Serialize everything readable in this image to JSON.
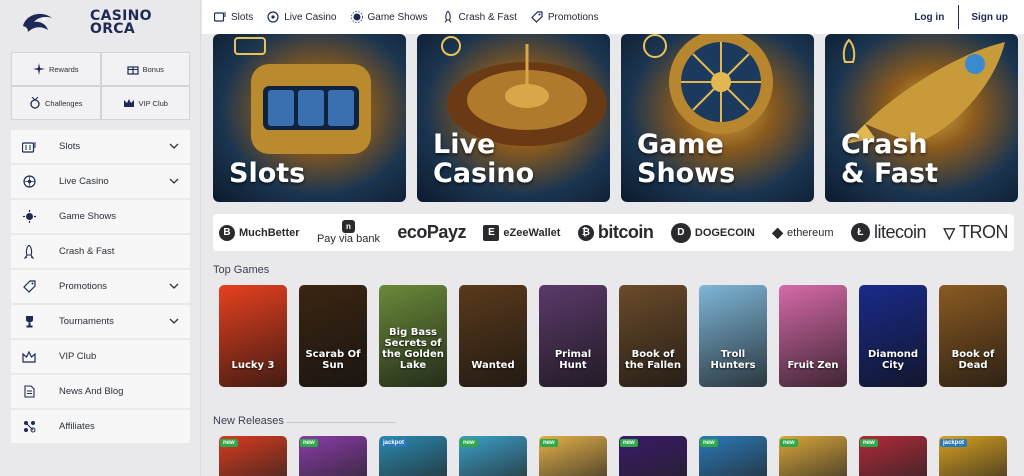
{
  "brand": {
    "line1": "CASINO",
    "line2": "ORCA",
    "color": "#1e2a55"
  },
  "quick_links": [
    {
      "label": "Rewards",
      "icon": "sparkle-icon"
    },
    {
      "label": "Bonus",
      "icon": "gift-icon"
    },
    {
      "label": "Challenges",
      "icon": "medal-icon"
    },
    {
      "label": "VIP Club",
      "icon": "crown-icon"
    }
  ],
  "sidebar": {
    "items": [
      {
        "label": "Slots",
        "icon": "slot-machine-icon",
        "has_chevron": true
      },
      {
        "label": "Live Casino",
        "icon": "roulette-icon",
        "has_chevron": true
      },
      {
        "label": "Game Shows",
        "icon": "wheel-icon",
        "has_chevron": false
      },
      {
        "label": "Crash & Fast",
        "icon": "rocket-icon",
        "has_chevron": false
      },
      {
        "label": "Promotions",
        "icon": "tag-icon",
        "has_chevron": true
      },
      {
        "label": "Tournaments",
        "icon": "trophy-icon",
        "has_chevron": true
      },
      {
        "label": "VIP Club",
        "icon": "crown-icon",
        "has_chevron": false
      },
      {
        "label": "News And Blog",
        "icon": "document-icon",
        "has_chevron": false
      },
      {
        "label": "Affiliates",
        "icon": "network-icon",
        "has_chevron": false
      }
    ]
  },
  "topnav": {
    "items": [
      {
        "label": "Slots",
        "icon": "slot-machine-icon"
      },
      {
        "label": "Live Casino",
        "icon": "roulette-icon"
      },
      {
        "label": "Game Shows",
        "icon": "wheel-icon"
      },
      {
        "label": "Crash & Fast",
        "icon": "rocket-icon"
      },
      {
        "label": "Promotions",
        "icon": "tag-icon"
      }
    ],
    "login": "Log in",
    "signup": "Sign up"
  },
  "heroes": [
    {
      "line1": "Slots",
      "line2": ""
    },
    {
      "line1": "Live",
      "line2": "Casino"
    },
    {
      "line1": "Game",
      "line2": "Shows"
    },
    {
      "line1": "Crash",
      "line2": "& Fast"
    }
  ],
  "payments": [
    "MuchBetter",
    "Pay via bank",
    "ecoPayz",
    "eZeeWallet",
    "bitcoin",
    "DOGECOIN",
    "ethereum",
    "litecoin",
    "TRON"
  ],
  "top_games": {
    "title": "Top Games",
    "games": [
      {
        "name": "Lucky 3",
        "bg": "#e8401f"
      },
      {
        "name": "Scarab Of Sun",
        "bg": "#3b2512"
      },
      {
        "name": "Big Bass Secrets of the Golden Lake",
        "bg": "#6a8a3a"
      },
      {
        "name": "Wanted",
        "bg": "#5a3a1c"
      },
      {
        "name": "Primal Hunt",
        "bg": "#5b3a6a"
      },
      {
        "name": "Book of the Fallen",
        "bg": "#6b4b2a"
      },
      {
        "name": "Troll Hunters",
        "bg": "#7fb6d8"
      },
      {
        "name": "Fruit Zen",
        "bg": "#d66aa8"
      },
      {
        "name": "Diamond City",
        "bg": "#1a2a8a"
      },
      {
        "name": "Book of Dead",
        "bg": "#8a5a22"
      }
    ]
  },
  "new_releases": {
    "title": "New Releases",
    "tiles": [
      {
        "badge": "new",
        "bg": "#d93b1f"
      },
      {
        "badge": "new",
        "bg": "#8a3ca8"
      },
      {
        "badge": "jackpot",
        "bg": "#2a8ab0"
      },
      {
        "badge": "new",
        "bg": "#3aa0c8"
      },
      {
        "badge": "new",
        "bg": "#e3b048"
      },
      {
        "badge": "new",
        "bg": "#3a1a6a"
      },
      {
        "badge": "new",
        "bg": "#2a7ab8"
      },
      {
        "badge": "new",
        "bg": "#d8a63a"
      },
      {
        "badge": "new",
        "bg": "#b02a3a"
      },
      {
        "badge": "jackpot",
        "bg": "#d8a020"
      }
    ]
  }
}
